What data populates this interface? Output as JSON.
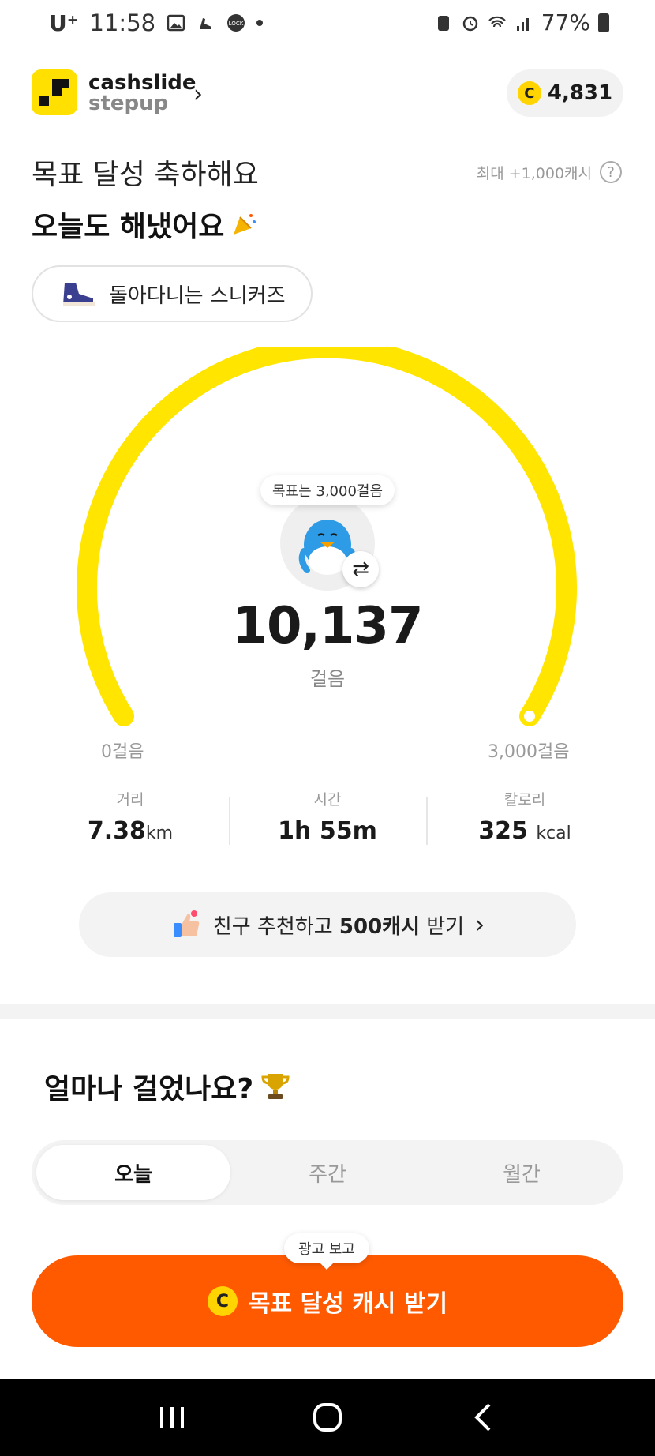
{
  "status_bar": {
    "carrier": "U⁺",
    "time": "11:58",
    "battery": "77%",
    "icons": [
      "image-icon",
      "sneaker-icon",
      "lock-app-icon",
      "dot-icon",
      "recycle-icon",
      "alarm-icon",
      "wifi-icon",
      "signal-icon",
      "battery-icon"
    ]
  },
  "header": {
    "brand_name": "cashslide",
    "brand_sub": "stepup",
    "points": "4,831",
    "coin_symbol": "C"
  },
  "headline": {
    "line1": "목표 달성 축하해요",
    "line2": "오늘도 해냈어요",
    "max_reward": "최대 +1,000캐시",
    "help": "?"
  },
  "sneaker_chip": {
    "label": "돌아다니는 스니커즈"
  },
  "gauge": {
    "goal_label": "목표는 3,000걸음",
    "steps": "10,137",
    "unit": "걸음",
    "min_label": "0걸음",
    "max_label": "3,000걸음",
    "progress": 1.0,
    "color": "#FFE500"
  },
  "stats": [
    {
      "label": "거리",
      "value": "7.38",
      "unit": "km"
    },
    {
      "label": "시간",
      "value": "1h 55m",
      "unit": ""
    },
    {
      "label": "칼로리",
      "value": "325",
      "unit": "kcal"
    }
  ],
  "referral": {
    "prefix": "친구 추천하고 ",
    "highlight": "500캐시",
    "suffix": " 받기"
  },
  "section": {
    "title": "얼마나 걸었나요?"
  },
  "tabs": [
    {
      "label": "오늘",
      "active": true
    },
    {
      "label": "주간",
      "active": false
    },
    {
      "label": "월간",
      "active": false
    }
  ],
  "cta": {
    "ad_label": "광고 보고",
    "label": "목표 달성 캐시 받기",
    "color": "#FF5A00"
  }
}
